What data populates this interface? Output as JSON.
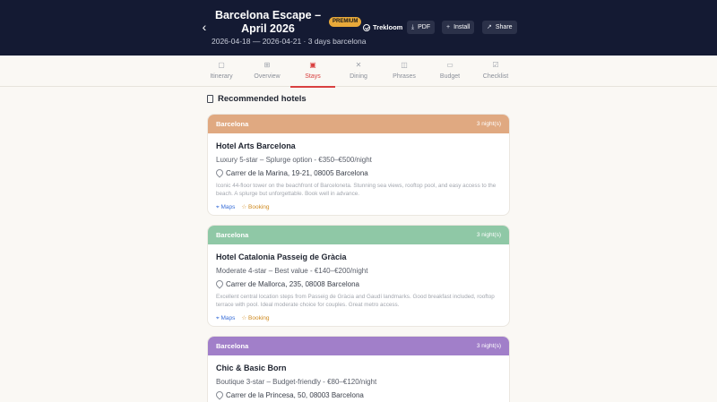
{
  "header": {
    "back_icon": "chevron-left-icon",
    "title": "Barcelona Escape – April 2026",
    "badge": "PREMIUM",
    "subtitle": "2026-04-18 — 2026-04-21 · 3 days barcelona",
    "brand": "Trekloom",
    "buttons": [
      {
        "label": "PDF",
        "icon": "download-icon"
      },
      {
        "label": "Install",
        "icon": "plus-icon"
      },
      {
        "label": "Share",
        "icon": "share-arrow-icon"
      }
    ],
    "colors": {
      "background": "#141a33",
      "badge": "#e8a93a"
    }
  },
  "tabs": [
    {
      "label": "Itinerary",
      "icon": "calendar-icon",
      "active": false
    },
    {
      "label": "Overview",
      "icon": "grid-icon",
      "active": false
    },
    {
      "label": "Stays",
      "icon": "hotel-icon",
      "active": true
    },
    {
      "label": "Dining",
      "icon": "utensils-icon",
      "active": false
    },
    {
      "label": "Phrases",
      "icon": "book-icon",
      "active": false
    },
    {
      "label": "Budget",
      "icon": "wallet-icon",
      "active": false
    },
    {
      "label": "Checklist",
      "icon": "checkbox-icon",
      "active": false
    }
  ],
  "section": {
    "title": "Recommended hotels",
    "icon": "building-icon"
  },
  "hotels": [
    {
      "city": "Barcelona",
      "nights": "3 night(s)",
      "color": "#e0a981",
      "name": "Hotel Arts Barcelona",
      "meta": "Luxury 5-star – Splurge option - €350–€500/night",
      "address": "Carrer de la Marina, 19-21, 08005 Barcelona",
      "description": "Iconic 44-floor tower on the beachfront of Barceloneta. Stunning sea views, rooftop pool, and easy access to the beach. A splurge but unforgettable. Book well in advance.",
      "maps_label": "Maps",
      "booking_label": "Booking"
    },
    {
      "city": "Barcelona",
      "nights": "3 night(s)",
      "color": "#8fc8a6",
      "name": "Hotel Catalonia Passeig de Gràcia",
      "meta": "Moderate 4-star – Best value - €140–€200/night",
      "address": "Carrer de Mallorca, 235, 08008 Barcelona",
      "description": "Excellent central location steps from Passeig de Gràcia and Gaudí landmarks. Good breakfast included, rooftop terrace with pool. Ideal moderate choice for couples. Great metro access.",
      "maps_label": "Maps",
      "booking_label": "Booking"
    },
    {
      "city": "Barcelona",
      "nights": "3 night(s)",
      "color": "#a17fc9",
      "name": "Chic & Basic Born",
      "meta": "Boutique 3-star – Budget-friendly - €80–€120/night",
      "address": "Carrer de la Princesa, 50, 08003 Barcelona",
      "description": "",
      "maps_label": "Maps",
      "booking_label": "Booking"
    }
  ]
}
